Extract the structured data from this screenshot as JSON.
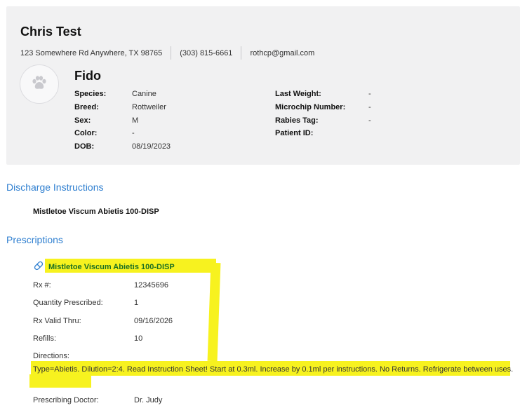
{
  "owner": {
    "name": "Chris Test",
    "address": "123 Somewhere Rd Anywhere, TX 98765",
    "phone": "(303) 815-6661",
    "email": "rothcp@gmail.com"
  },
  "patient": {
    "name": "Fido",
    "avatar_icon": "paw-icon",
    "left_fields": [
      {
        "label": "Species:",
        "value": "Canine"
      },
      {
        "label": "Breed:",
        "value": "Rottweiler"
      },
      {
        "label": "Sex:",
        "value": "M"
      },
      {
        "label": "Color:",
        "value": "-"
      },
      {
        "label": "DOB:",
        "value": "08/19/2023"
      }
    ],
    "right_fields": [
      {
        "label": "Last Weight:",
        "value": "-"
      },
      {
        "label": "Microchip Number:",
        "value": "-"
      },
      {
        "label": "Rabies Tag:",
        "value": "-"
      },
      {
        "label": "Patient ID:",
        "value": ""
      }
    ]
  },
  "discharge": {
    "title": "Discharge Instructions",
    "item": "Mistletoe Viscum Abietis 100-DISP"
  },
  "prescriptions": {
    "title": "Prescriptions",
    "item_icon": "pill-icon",
    "item_title": "Mistletoe Viscum Abietis 100-DISP",
    "fields": [
      {
        "label": "Rx #:",
        "value": "12345696"
      },
      {
        "label": "Quantity Prescribed:",
        "value": "1"
      },
      {
        "label": "Rx Valid Thru:",
        "value": "09/16/2026"
      },
      {
        "label": "Refills:",
        "value": "10"
      }
    ],
    "directions_label": "Directions:",
    "directions_text": "Type=Abietis. Dilution=2:4. Read Instruction Sheet! Start at 0.3ml. Increase by 0.1ml per instructions. No Returns. Refrigerate between uses.",
    "doctor_label": "Prescribing Doctor:",
    "doctor_value": "Dr. Judy"
  },
  "colors": {
    "section_title": "#2f7fd0",
    "highlight": "#f7f21f",
    "highlighted_title_text": "#1b6f22",
    "card_background": "#f1f1f2"
  }
}
